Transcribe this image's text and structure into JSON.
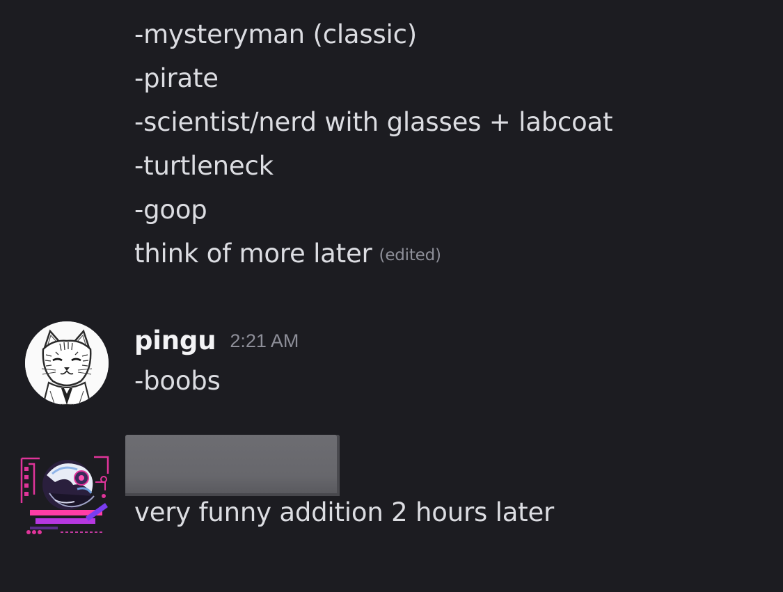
{
  "continued_message": {
    "lines": [
      "-mysteryman (classic)",
      "-pirate",
      "-scientist/nerd with glasses + labcoat",
      "-turtleneck",
      "-goop",
      "think of more later"
    ],
    "edited_label": "(edited)"
  },
  "messages": [
    {
      "username": "pingu",
      "timestamp": "2:21 AM",
      "text": "-boobs",
      "avatar_icon": "cat-sketch-avatar-icon"
    },
    {
      "username_redacted": true,
      "text": "very funny addition 2 hours later",
      "avatar_icon": "pink-cyber-avatar-icon"
    }
  ],
  "colors": {
    "background": "#1c1c21",
    "text": "#dcdde2",
    "muted": "#8e8f99",
    "username": "#f3f3f5",
    "redaction": "#6b6b70"
  }
}
